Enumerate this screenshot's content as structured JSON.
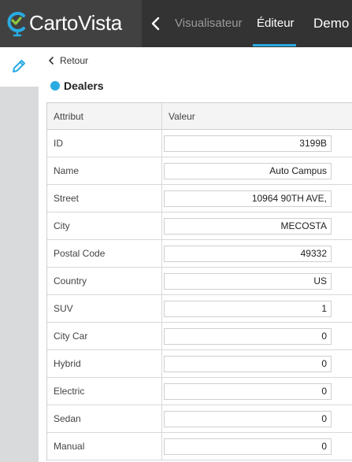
{
  "app": {
    "logo_text": "CartoVista",
    "nav": {
      "visualiser": "Visualisateur",
      "editor": "Éditeur",
      "project": "Demo"
    },
    "accent_color": "#29abe2"
  },
  "panel": {
    "back_label": "Retour",
    "layer_name": "Dealers",
    "columns": {
      "attribute": "Attribut",
      "value": "Valeur"
    },
    "rows": [
      {
        "attribute": "ID",
        "value": "3199B"
      },
      {
        "attribute": "Name",
        "value": "Auto Campus"
      },
      {
        "attribute": "Street",
        "value": "10964 90TH AVE,"
      },
      {
        "attribute": "City",
        "value": "MECOSTA"
      },
      {
        "attribute": "Postal Code",
        "value": "49332"
      },
      {
        "attribute": "Country",
        "value": "US"
      },
      {
        "attribute": "SUV",
        "value": "1"
      },
      {
        "attribute": "City Car",
        "value": "0"
      },
      {
        "attribute": "Hybrid",
        "value": "0"
      },
      {
        "attribute": "Electric",
        "value": "0"
      },
      {
        "attribute": "Sedan",
        "value": "0"
      },
      {
        "attribute": "Manual",
        "value": "0"
      }
    ]
  }
}
